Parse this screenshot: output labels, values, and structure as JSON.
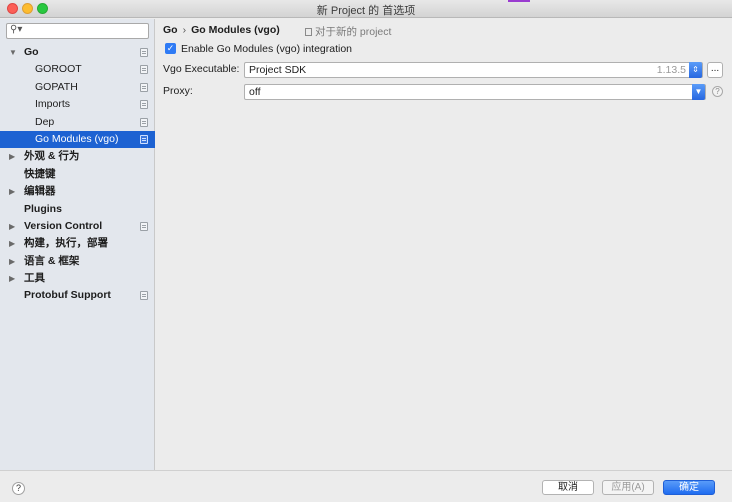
{
  "window": {
    "title": "新 Project 的 首选项"
  },
  "sidebar": {
    "search_placeholder": "",
    "items": [
      {
        "label": "Go",
        "expanded": true
      },
      {
        "label": "GOROOT"
      },
      {
        "label": "GOPATH"
      },
      {
        "label": "Imports"
      },
      {
        "label": "Dep"
      },
      {
        "label": "Go Modules (vgo)",
        "selected": true
      },
      {
        "label": "外观 & 行为",
        "expanded": false
      },
      {
        "label": "快捷键"
      },
      {
        "label": "编辑器",
        "expanded": false
      },
      {
        "label": "Plugins"
      },
      {
        "label": "Version Control",
        "expanded": false
      },
      {
        "label": "构建，执行，部署",
        "expanded": false
      },
      {
        "label": "语言 & 框架",
        "expanded": false
      },
      {
        "label": "工具",
        "expanded": false
      },
      {
        "label": "Protobuf Support"
      }
    ]
  },
  "main": {
    "breadcrumb": {
      "root": "Go",
      "separator": "›",
      "current": "Go Modules (vgo)"
    },
    "scope_label": "对于新的 project",
    "enable_checkbox": {
      "label": "Enable Go Modules (vgo) integration",
      "checked": true
    },
    "vgo_executable": {
      "label": "Vgo Executable:",
      "value": "Project SDK",
      "version": "1.13.5",
      "browse_label": "..."
    },
    "proxy": {
      "label": "Proxy:",
      "value": "off"
    }
  },
  "footer": {
    "help": "?",
    "cancel": "取消",
    "apply": "应用(A)",
    "ok": "确定"
  },
  "colors": {
    "selection": "#1d62d2",
    "accent": "#2f7bf5"
  }
}
